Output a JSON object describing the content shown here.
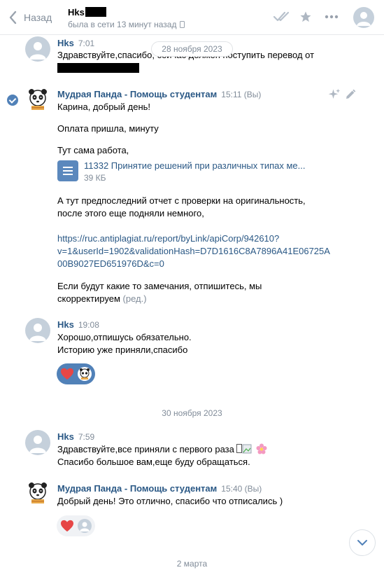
{
  "header": {
    "back_label": "Назад",
    "chat_name": "Hks",
    "status": "была в сети 13 минут назад"
  },
  "dates": {
    "first": "28 ноября 2023",
    "second": "30 ноября 2023",
    "third": "2 марта"
  },
  "messages": [
    {
      "author": "Hks",
      "time": "7:01",
      "text": "Здравствуйте,спасибо, сейчас должен поступить перевод от"
    },
    {
      "author": "Мудрая Панда - Помощь студентам",
      "time": "15:11 (Вы)",
      "lines": [
        "Карина, добрый день!",
        "Оплата пришла, минуту",
        "Тут сама работа,",
        "А тут предпоследний отчет с проверки на оригинальность,",
        "после этого еще подняли немного,",
        "Если будут какие то замечания, отпишитесь, мы",
        "скорректируем"
      ],
      "edited_label": "(ред.)",
      "file": {
        "name": "11332 Принятие решений при различных типах ме...",
        "size": "39 КБ"
      },
      "link_lines": [
        "https://ruc.antiplagiat.ru/report/byLink/apiCorp/942610?",
        "v=1&userId=1902&validationHash=D7D1616C8A7896A41E06725A",
        "00B9027ED651976D&c=0"
      ]
    },
    {
      "author": "Hks",
      "time": "19:08",
      "lines": [
        "Хорошо,отпишусь обязательно.",
        "Историю уже приняли,спасибо"
      ]
    },
    {
      "author": "Hks",
      "time": "7:59",
      "lines": [
        "Здравствуйте,все приняли с первого раза",
        "Спасибо большое вам,еще буду обращаться."
      ]
    },
    {
      "author": "Мудрая Панда - Помощь студентам",
      "time": "15:40 (Вы)",
      "lines": [
        "Добрый день! Это отлично, спасибо что отписались )"
      ]
    }
  ],
  "colors": {
    "accent": "#5181b8",
    "link": "#2a5885",
    "muted": "#818c99",
    "heart": "#e64646"
  },
  "icons": [
    "chevron-left-icon",
    "double-check-icon",
    "star-icon",
    "more-icon",
    "sparkle-icon",
    "pencil-icon",
    "document-icon",
    "heart-icon",
    "chevron-down-icon",
    "flower-icon"
  ]
}
